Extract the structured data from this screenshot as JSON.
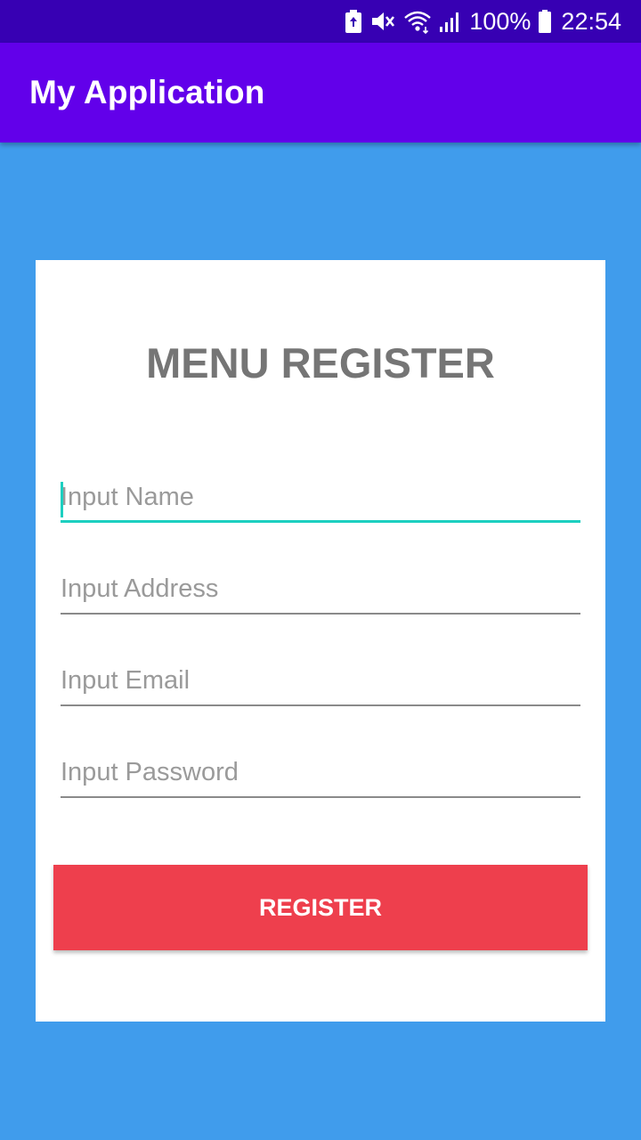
{
  "status_bar": {
    "battery": "100%",
    "time": "22:54",
    "icons": [
      "battery-saver-icon",
      "mute-icon",
      "wifi-icon",
      "signal-icon",
      "battery-icon"
    ]
  },
  "app_bar": {
    "title": "My Application"
  },
  "form": {
    "title": "MENU REGISTER",
    "fields": [
      {
        "placeholder": "Input Name",
        "value": "",
        "focused": true
      },
      {
        "placeholder": "Input Address",
        "value": ""
      },
      {
        "placeholder": "Input Email",
        "value": ""
      },
      {
        "placeholder": "Input Password",
        "value": ""
      }
    ],
    "register_label": "REGISTER"
  },
  "colors": {
    "status_bar": "#3700b3",
    "app_bar": "#6200ea",
    "background": "#409cec",
    "card": "#ffffff",
    "accent": "#1ccfc0",
    "button": "#ee3f4d"
  }
}
